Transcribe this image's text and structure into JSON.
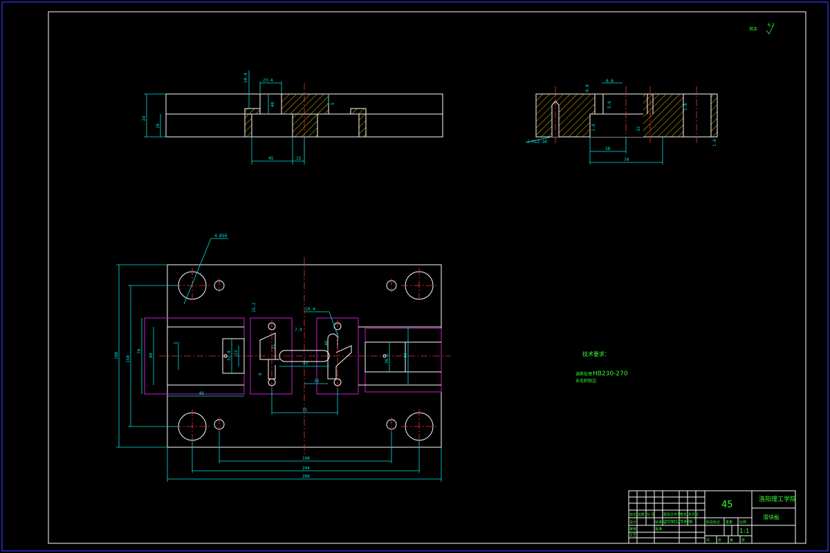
{
  "drawing": {
    "roughness_note": "6.3",
    "top_view": {
      "dims": [
        "10.4",
        "23.4",
        "40",
        "24",
        "16",
        "32",
        "5",
        "45",
        "15"
      ]
    },
    "side_view": {
      "dims": [
        "0.8",
        "5.6",
        "2-M12-30",
        "38",
        "70",
        "32",
        "1.6",
        "1.6",
        "1.6",
        "0.8"
      ]
    },
    "plan_view": {
      "hole_callout": "4-Ø30",
      "dims": [
        "180",
        "150",
        "70",
        "40",
        "5",
        "32.4",
        "23",
        "85",
        "15.2",
        "10.4",
        "7.9",
        "21",
        "8",
        "48",
        "47",
        "26",
        "71",
        "36.1",
        "40",
        "198",
        "244",
        "286"
      ]
    },
    "tech_requirements": {
      "title": "技术要求：",
      "line1_prefix": "调质处理",
      "line1_value": "HB230-270",
      "line2": "去毛刺锐边"
    }
  },
  "title_block": {
    "material": "45",
    "school": "洛阳理工学院",
    "part_name": "滑块板",
    "drawing_number": "Z09D25906",
    "scale": "1:1",
    "header_labels": [
      "标记",
      "处数",
      "分 区",
      "更改文件号",
      "签名",
      "年月日"
    ],
    "row_labels": [
      "设计",
      "标准化",
      "审核",
      "工艺",
      "批准"
    ],
    "column_labels": [
      "阶段标记",
      "重量",
      "比例"
    ],
    "footer_labels": [
      "共",
      "张",
      "第",
      "张"
    ]
  },
  "colors": {
    "background": "#000000",
    "outline": "#ffffff",
    "dimension": "#00e5e5",
    "centerline": "#ff3030",
    "magenta_feature": "#d020d0",
    "annotation": "#33ff33",
    "border": "#3838ff"
  }
}
